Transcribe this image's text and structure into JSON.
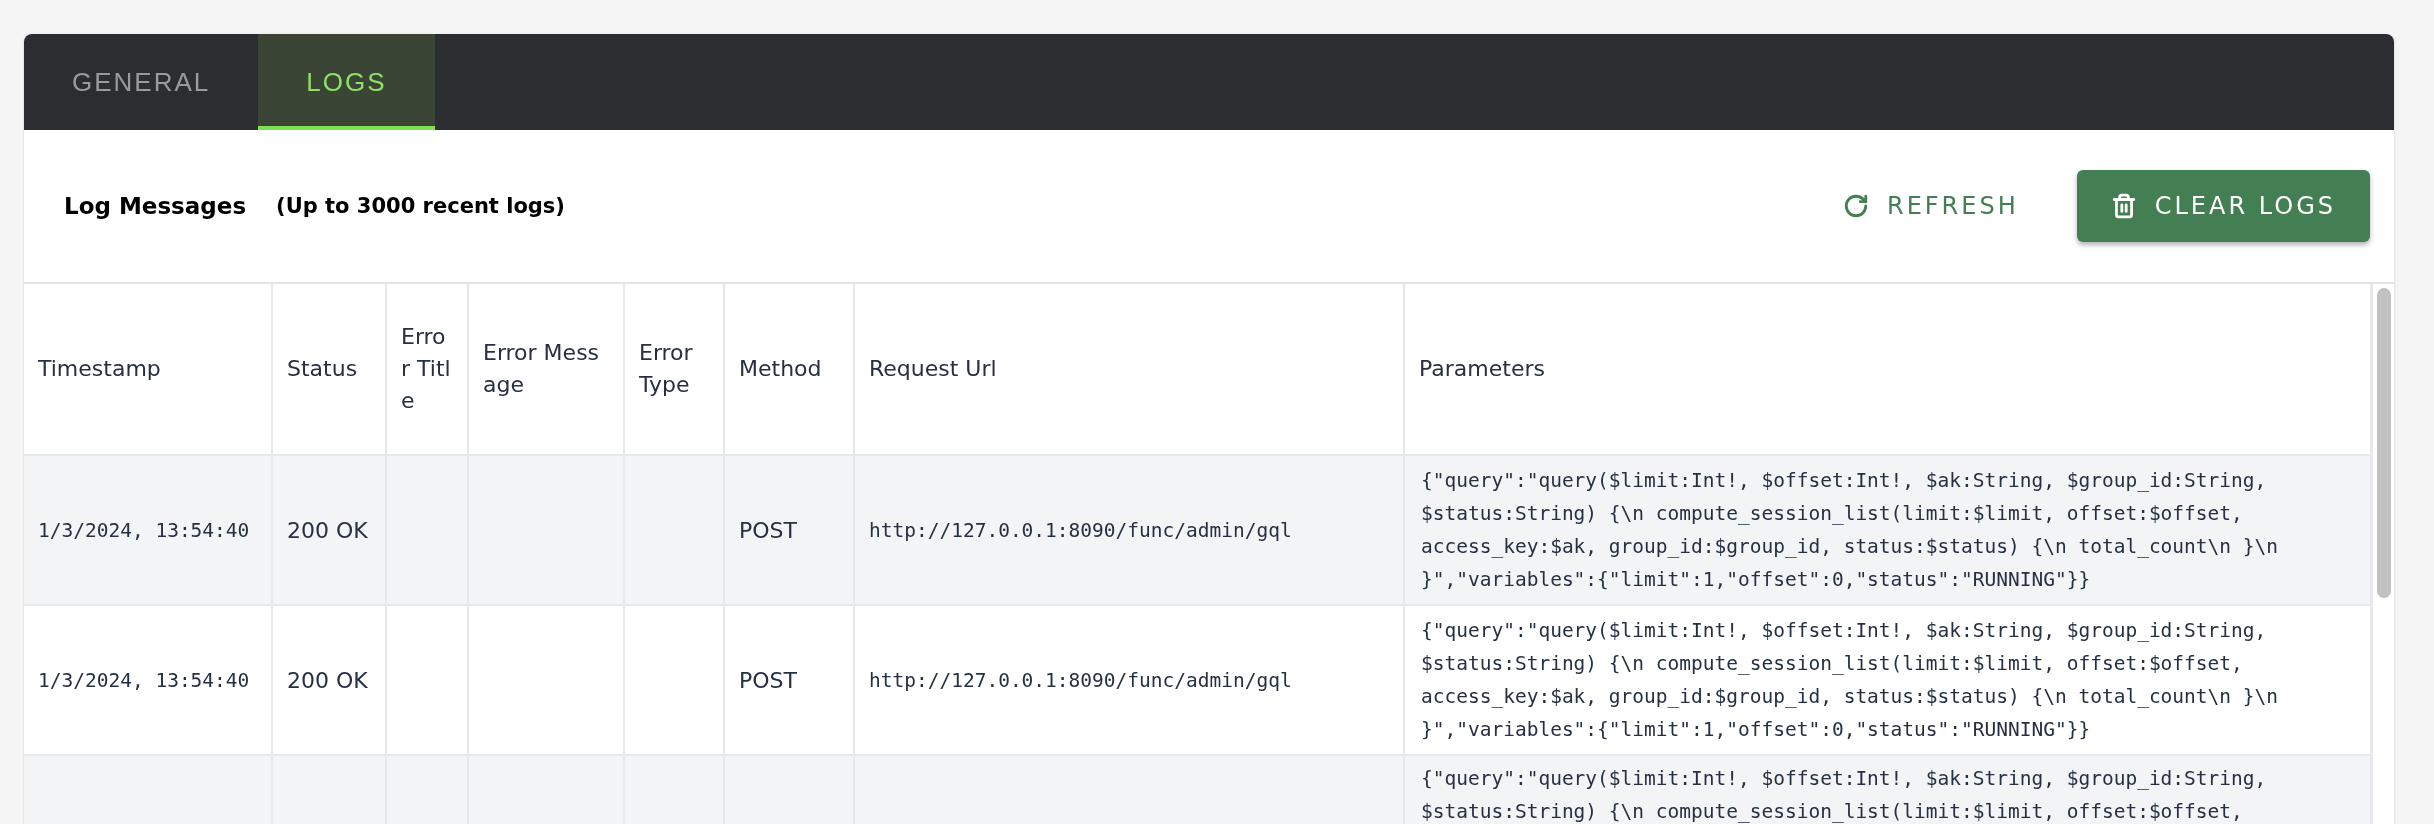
{
  "tabs": [
    {
      "label": "GENERAL",
      "selected": false
    },
    {
      "label": "LOGS",
      "selected": true
    }
  ],
  "toolbar": {
    "title": "Log Messages",
    "subtitle": "(Up to 3000 recent logs)",
    "buttons": [
      {
        "label": "REFRESH",
        "kind": "text"
      },
      {
        "label": "CLEAR LOGS",
        "kind": "contained"
      }
    ]
  },
  "table": {
    "columns": [
      "Timestamp",
      "Status",
      "Error Title",
      "Error Message",
      "Error Type",
      "Method",
      "Request Url",
      "Parameters"
    ],
    "rows": [
      {
        "cells": [
          "1/3/2024, 13:54:40",
          "200 OK",
          "",
          "",
          "",
          "POST",
          "http://127.0.0.1:8090/func/admin/gql",
          "{\"query\":\"query($limit:Int!, $offset:Int!, $ak:String, $group_id:String, $status:String) {\\n compute_session_list(limit:$limit, offset:$offset, access_key:$ak, group_id:$group_id, status:$status) {\\n total_count\\n }\\n }\",\"variables\":{\"limit\":1,\"offset\":0,\"status\":\"RUNNING\"}}"
        ]
      },
      {
        "cells": [
          "1/3/2024, 13:54:40",
          "200 OK",
          "",
          "",
          "",
          "POST",
          "http://127.0.0.1:8090/func/admin/gql",
          "{\"query\":\"query($limit:Int!, $offset:Int!, $ak:String, $group_id:String, $status:String) {\\n compute_session_list(limit:$limit, offset:$offset, access_key:$ak, group_id:$group_id, status:$status) {\\n total_count\\n }\\n }\",\"variables\":{\"limit\":1,\"offset\":0,\"status\":\"RUNNING\"}}"
        ]
      },
      {
        "cells": [
          "",
          "",
          "",
          "",
          "",
          "",
          "",
          "{\"query\":\"query($limit:Int!, $offset:Int!, $ak:String, $group_id:String, $status:String) {\\n compute_session_list(limit:$limit, offset:$offset,"
        ]
      }
    ]
  }
}
